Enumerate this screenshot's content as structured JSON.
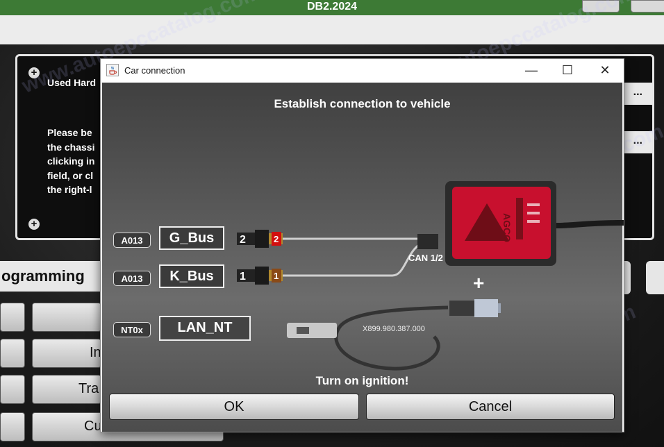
{
  "app": {
    "title": "DB2.2024",
    "used_hardware_label": "Used Hard",
    "instructions": [
      "Please be",
      "the chassi",
      "clicking in",
      "field, or cl",
      "the right-l"
    ],
    "more_button_label": "...",
    "section_label": "ogramming",
    "menu_buttons": [
      "",
      "In",
      "Tra",
      "Cu"
    ]
  },
  "dialog": {
    "title": "Car connection",
    "heading": "Establish connection to vehicle",
    "connections": [
      {
        "adapter": "A013",
        "bus": "G_Bus",
        "pin": "2"
      },
      {
        "adapter": "A013",
        "bus": "K_Bus",
        "pin": "1"
      }
    ],
    "lan": {
      "adapter": "NT0x",
      "name": "LAN_NT"
    },
    "can_label": "CAN 1/2",
    "plus_label": "+",
    "cable_part_number": "X899.980.387.000",
    "device_brand": "AGCO",
    "instruction": "Turn on ignition!",
    "ok_label": "OK",
    "cancel_label": "Cancel",
    "window_controls": {
      "minimize": "—",
      "maximize": "☐",
      "close": "✕"
    }
  },
  "watermark": "www.autoepccatalog.com",
  "colors": {
    "titlebar_green": "#3d7a35",
    "device_red": "#c8102e",
    "pin2_red": "#d20f0f",
    "pin1_brown": "#8a4a17"
  }
}
